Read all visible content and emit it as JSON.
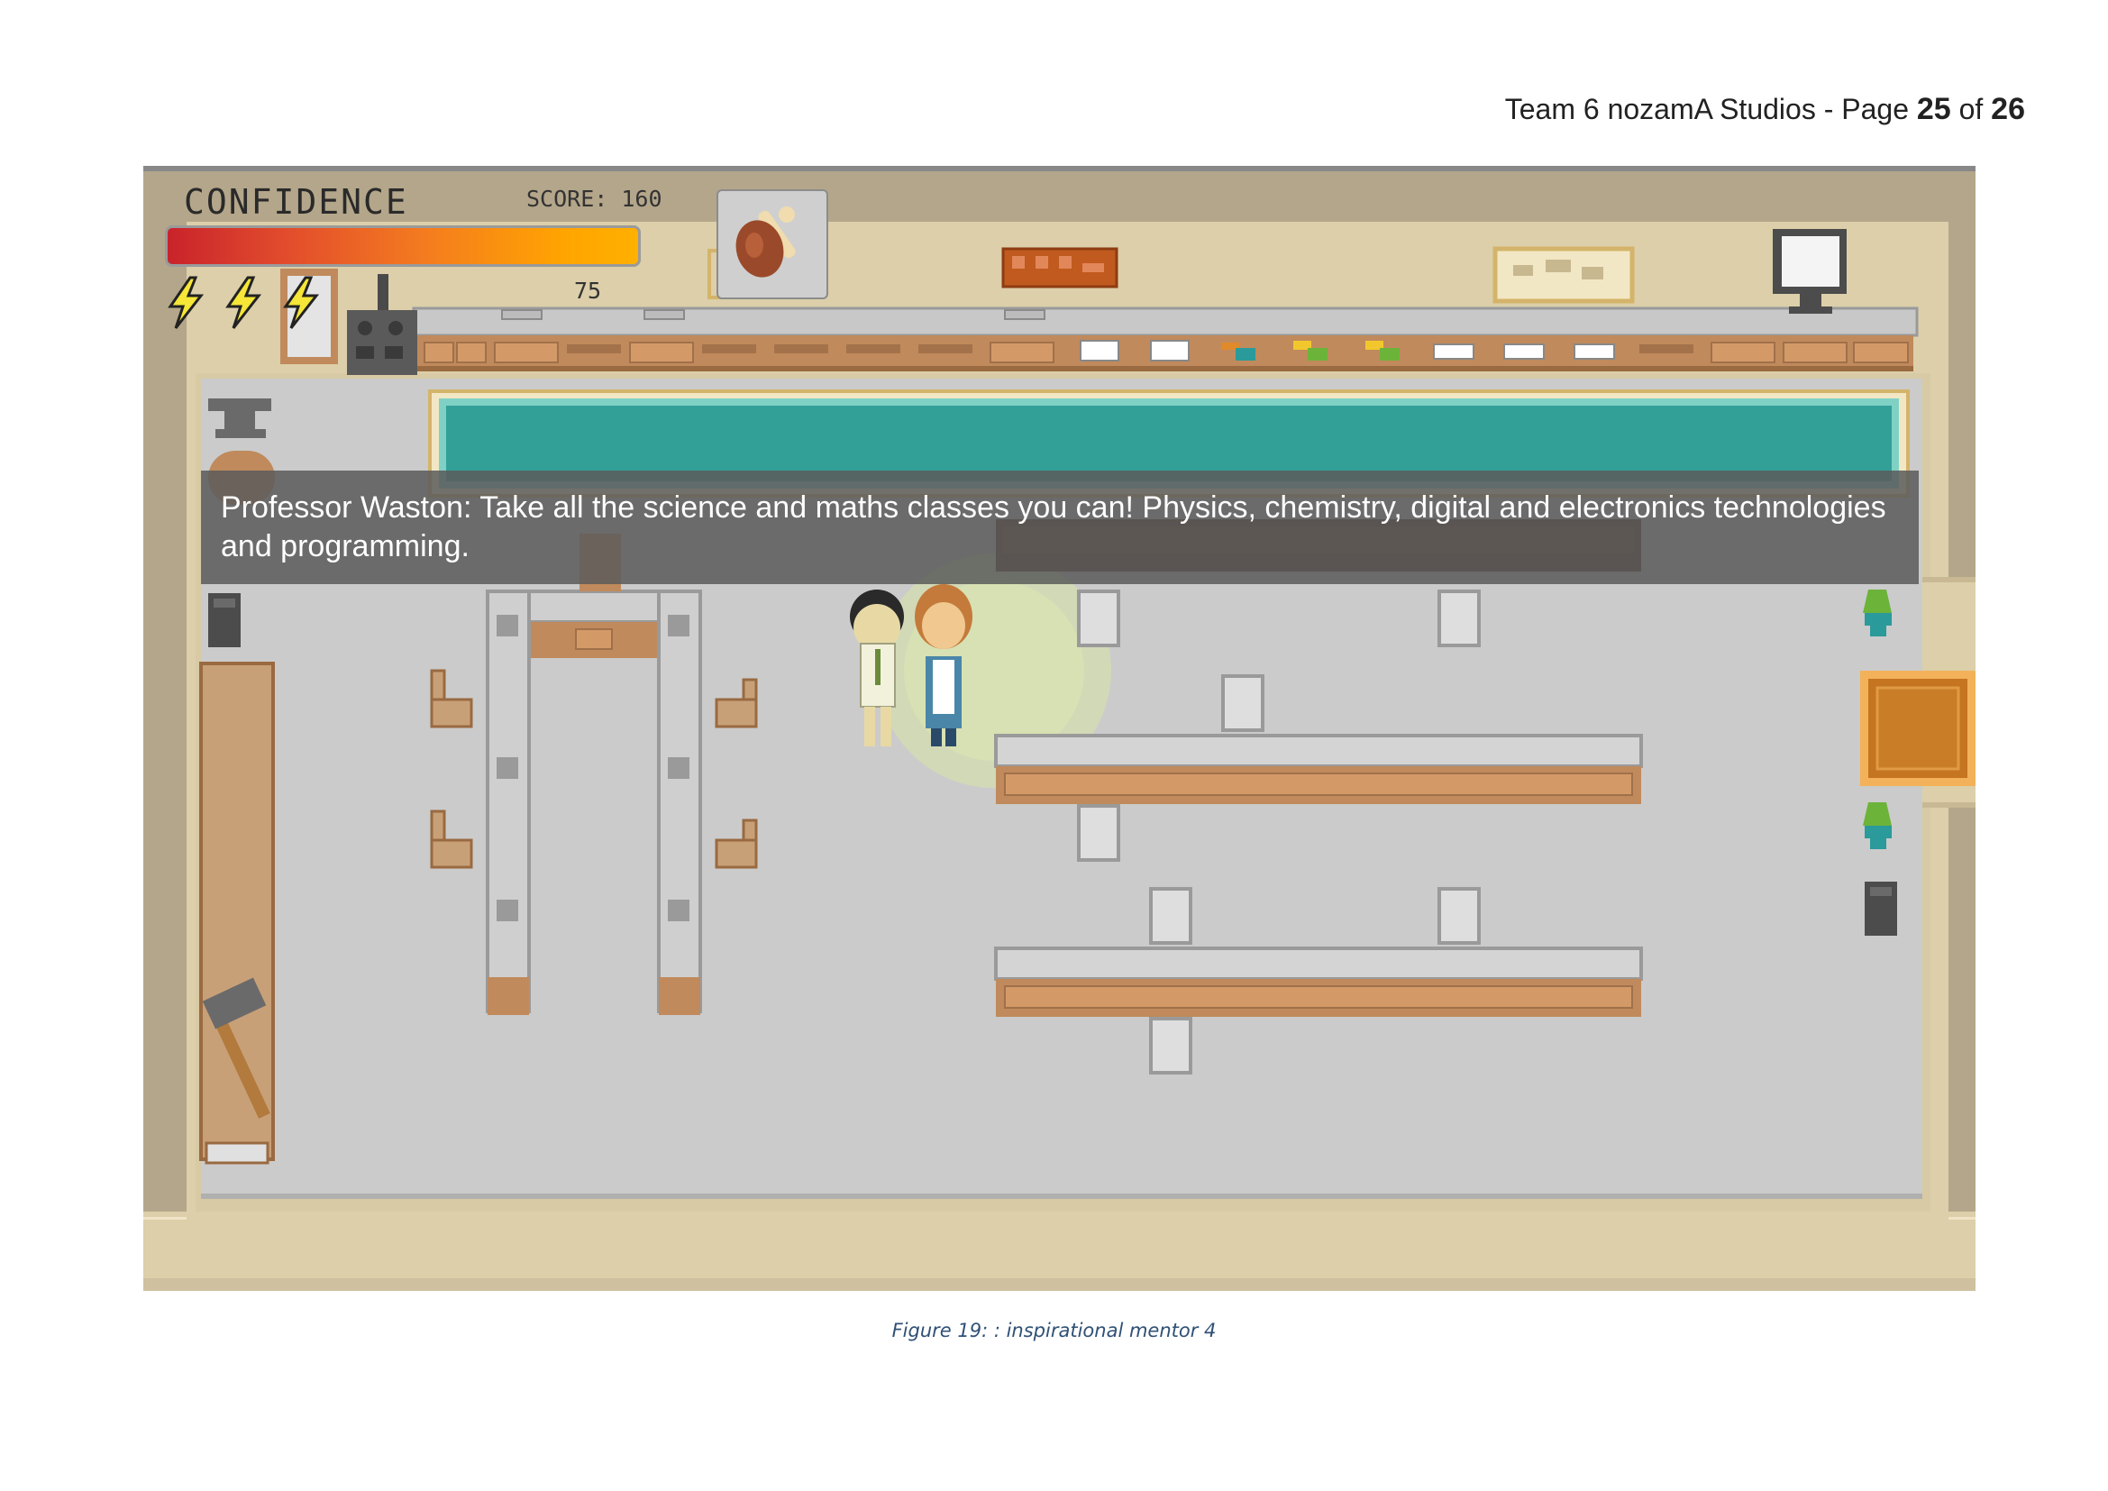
{
  "header": {
    "prefix": "Team 6 nozamA Studios - Page ",
    "page": "25",
    "of": " of ",
    "total": "26"
  },
  "game": {
    "confidence_label": "CONFIDENCE",
    "score_label": "SCORE: 160",
    "confidence_value": "75",
    "energy_bolts": 3,
    "confidence_fraction": 0.75,
    "dialog_text": "Professor Waston: Take all the science and maths classes you can! Physics, chemistry, digital and electronics technologies and programming.",
    "colors": {
      "floor": "#cbcbcb",
      "wall": "#b4a68a",
      "trim": "#dccfa9",
      "pool": "#33a098",
      "wood": "#c08a5c",
      "bolt": "#f5e637"
    }
  },
  "caption": "Figure 19: : inspirational mentor 4"
}
